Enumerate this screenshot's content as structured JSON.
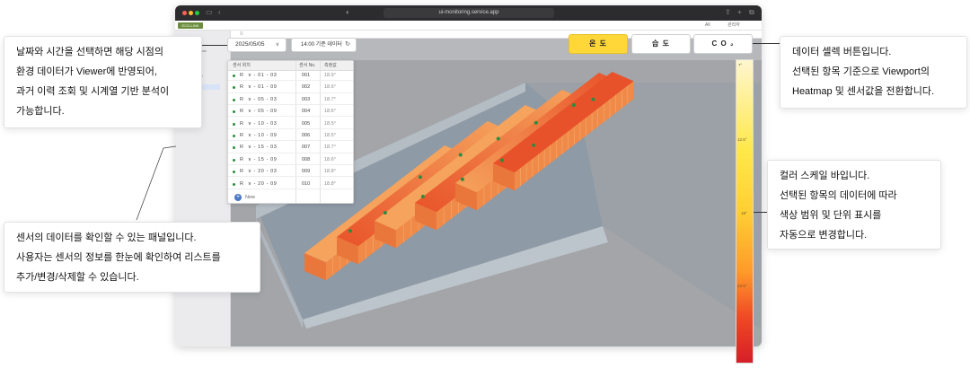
{
  "browser": {
    "url": "ui-monitoring.service.app",
    "logo": "ECO-LINK",
    "top_right": [
      "All",
      "관리자"
    ]
  },
  "controls": {
    "date": "2025/05/05",
    "time": "14:00  기준 데이터",
    "data_buttons": [
      "온 도",
      "습 도",
      "C O ₂"
    ],
    "active_button": "온 도"
  },
  "sensor_panel": {
    "columns": [
      "센서 위치",
      "센서 No.",
      "측정값"
    ],
    "rows": [
      {
        "loc": "R  ∨ - 01 - 03",
        "no": "001",
        "value": "18.5°"
      },
      {
        "loc": "R  ∨ - 01 - 09",
        "no": "002",
        "value": "18.6°"
      },
      {
        "loc": "R  ∨ - 05 - 03",
        "no": "003",
        "value": "18.7°"
      },
      {
        "loc": "R  ∨ - 05 - 09",
        "no": "004",
        "value": "18.6°"
      },
      {
        "loc": "R  ∨ - 10 - 03",
        "no": "005",
        "value": "18.5°"
      },
      {
        "loc": "R  ∨ - 10 - 09",
        "no": "006",
        "value": "18.5°"
      },
      {
        "loc": "R  ∨ - 15 - 03",
        "no": "007",
        "value": "18.7°"
      },
      {
        "loc": "R  ∨ - 15 - 09",
        "no": "008",
        "value": "18.6°"
      },
      {
        "loc": "R  ∨ - 20 - 03",
        "no": "009",
        "value": "18.8°"
      },
      {
        "loc": "R  ∨ - 20 - 09",
        "no": "010",
        "value": "18.8°"
      }
    ],
    "new_label": "New"
  },
  "color_scale": {
    "labels": [
      "7°",
      "12.5°",
      "18°",
      "23.5°"
    ]
  },
  "callouts": {
    "datetime": [
      "날짜와 시간을 선택하면 해당 시점의",
      "환경 데이터가 Viewer에 반영되어,",
      "과거 이력 조회 및 시계열 기반 분석이",
      "가능합니다."
    ],
    "panel": [
      "센서의 데이터를 확인할 수 있는 패널입니다.",
      "사용자는 센서의 정보를 한눈에 확인하여 리스트를",
      "추가/변경/삭제할 수 있습니다."
    ],
    "select": [
      "데이터 셀렉 버튼입니다.",
      "선택된 항목 기준으로 Viewport의",
      "Heatmap 및 센서값을 전환합니다."
    ],
    "scale": [
      "컬러 스케일 바입니다.",
      "선택된 항목의 데이터에 따라",
      "색상 범위 및 단위 표시를",
      "자동으로 변경합니다."
    ]
  },
  "colors": {
    "active_button": "#ffd738",
    "sensor_dot": "#2e8b3e",
    "heat_low": "#f5a35d",
    "heat_high": "#e8522a"
  }
}
